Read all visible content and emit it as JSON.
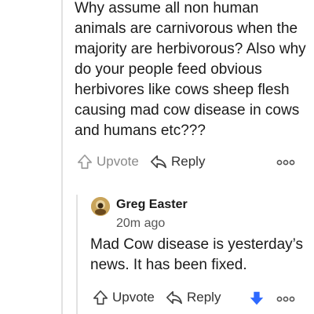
{
  "comment": {
    "body": "Why assume all non human animals are carnivorous when the majority are herbivorous? Also why do your people feed obvious herbivores like cows sheep flesh causing mad cow disease in cows and humans etc???",
    "actions": {
      "upvote_label": "Upvote",
      "reply_label": "Reply"
    }
  },
  "reply": {
    "author": "Greg Easter",
    "timestamp": "20m ago",
    "body": "Mad Cow disease is yesterday’s news. It has been fixed.",
    "actions": {
      "upvote_label": "Upvote",
      "reply_label": "Reply"
    },
    "downvote_color": "#2e69ff"
  },
  "icons": {
    "upvote": "upvote-arrow-icon",
    "reply": "reply-arrow-icon",
    "downvote": "downvote-arrow-icon",
    "more": "more-options-icon",
    "avatar": "user-avatar"
  }
}
